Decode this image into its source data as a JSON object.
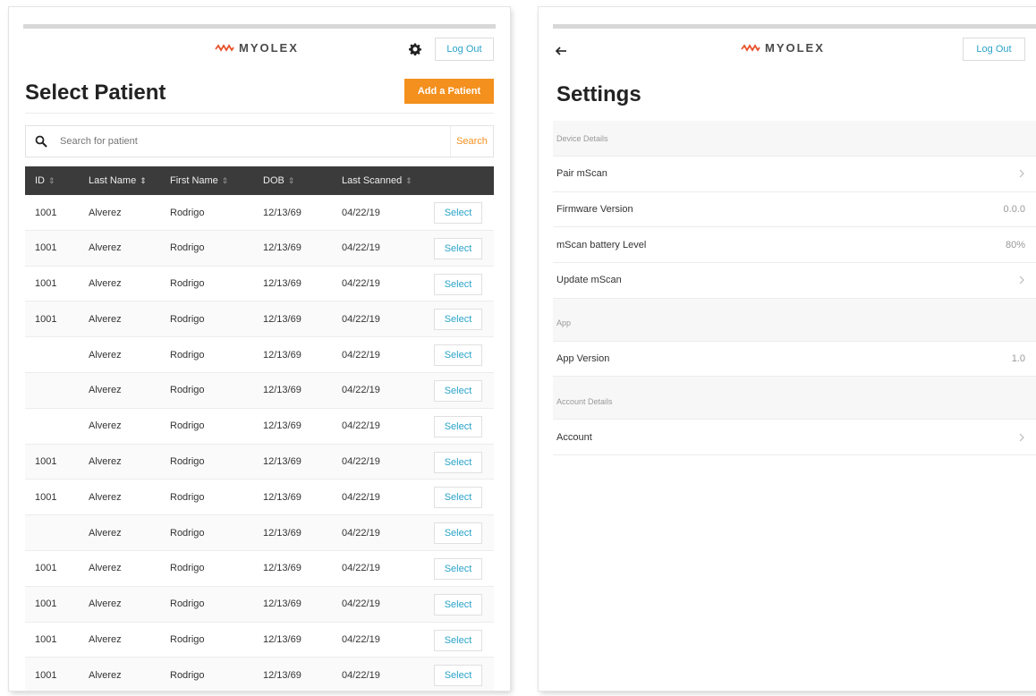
{
  "brand": {
    "name": "MYOLEX",
    "accent_color": "#f4901e",
    "link_color": "#2aa3c9"
  },
  "patients_screen": {
    "logout_label": "Log Out",
    "settings_icon": "gear-icon",
    "title": "Select Patient",
    "add_label": "Add a Patient",
    "search": {
      "placeholder": "Search for patient",
      "button_label": "Search",
      "icon": "search-icon"
    },
    "columns": [
      "ID",
      "Last Name",
      "First Name",
      "DOB",
      "Last Scanned"
    ],
    "rows": [
      {
        "id": "1001",
        "last": "Alverez",
        "first": "Rodrigo",
        "dob": "12/13/69",
        "scanned": "04/22/19",
        "action": "Select"
      },
      {
        "id": "1001",
        "last": "Alverez",
        "first": "Rodrigo",
        "dob": "12/13/69",
        "scanned": "04/22/19",
        "action": "Select"
      },
      {
        "id": "1001",
        "last": "Alverez",
        "first": "Rodrigo",
        "dob": "12/13/69",
        "scanned": "04/22/19",
        "action": "Select"
      },
      {
        "id": "1001",
        "last": "Alverez",
        "first": "Rodrigo",
        "dob": "12/13/69",
        "scanned": "04/22/19",
        "action": "Select"
      },
      {
        "id": "",
        "last": "Alverez",
        "first": "Rodrigo",
        "dob": "12/13/69",
        "scanned": "04/22/19",
        "action": "Select"
      },
      {
        "id": "",
        "last": "Alverez",
        "first": "Rodrigo",
        "dob": "12/13/69",
        "scanned": "04/22/19",
        "action": "Select"
      },
      {
        "id": "",
        "last": "Alverez",
        "first": "Rodrigo",
        "dob": "12/13/69",
        "scanned": "04/22/19",
        "action": "Select"
      },
      {
        "id": "1001",
        "last": "Alverez",
        "first": "Rodrigo",
        "dob": "12/13/69",
        "scanned": "04/22/19",
        "action": "Select"
      },
      {
        "id": "1001",
        "last": "Alverez",
        "first": "Rodrigo",
        "dob": "12/13/69",
        "scanned": "04/22/19",
        "action": "Select"
      },
      {
        "id": "",
        "last": "Alverez",
        "first": "Rodrigo",
        "dob": "12/13/69",
        "scanned": "04/22/19",
        "action": "Select"
      },
      {
        "id": "1001",
        "last": "Alverez",
        "first": "Rodrigo",
        "dob": "12/13/69",
        "scanned": "04/22/19",
        "action": "Select"
      },
      {
        "id": "1001",
        "last": "Alverez",
        "first": "Rodrigo",
        "dob": "12/13/69",
        "scanned": "04/22/19",
        "action": "Select"
      },
      {
        "id": "1001",
        "last": "Alverez",
        "first": "Rodrigo",
        "dob": "12/13/69",
        "scanned": "04/22/19",
        "action": "Select"
      },
      {
        "id": "1001",
        "last": "Alverez",
        "first": "Rodrigo",
        "dob": "12/13/69",
        "scanned": "04/22/19",
        "action": "Select"
      }
    ]
  },
  "settings_screen": {
    "back_icon": "arrow-left-icon",
    "logout_label": "Log Out",
    "title": "Settings",
    "sections": [
      {
        "header": "Device Details",
        "items": [
          {
            "label": "Pair mScan",
            "value": "",
            "chevron": true
          },
          {
            "label": "Firmware Version",
            "value": "0.0.0",
            "chevron": false
          },
          {
            "label": "mScan battery Level",
            "value": "80%",
            "chevron": false
          },
          {
            "label": "Update mScan",
            "value": "",
            "chevron": true
          }
        ]
      },
      {
        "header": "App",
        "items": [
          {
            "label": "App Version",
            "value": "1.0",
            "chevron": false
          }
        ]
      },
      {
        "header": "Account Details",
        "items": [
          {
            "label": "Account",
            "value": "",
            "chevron": true
          }
        ]
      }
    ]
  }
}
